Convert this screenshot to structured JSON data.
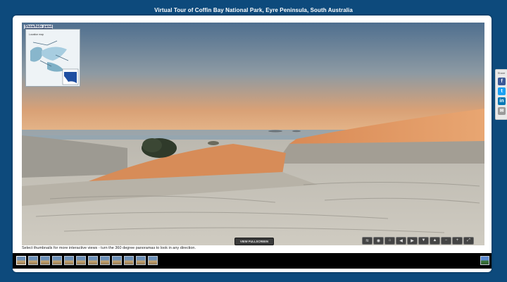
{
  "page": {
    "title": "Virtual Tour of Coffin Bay National Park, Eyre Peninsula, South Australia"
  },
  "map_panel": {
    "toggle_label": "Show/hide panel",
    "map_label": "Location map"
  },
  "viewer": {
    "fullscreen_label": "VIEW FULLSCREEN",
    "nav_buttons": [
      {
        "icon": "wifi-icon",
        "glyph": "≋"
      },
      {
        "icon": "hotspot-icon",
        "glyph": "◉"
      },
      {
        "icon": "home-icon",
        "glyph": "⌂"
      },
      {
        "icon": "arrow-left-icon",
        "glyph": "◀"
      },
      {
        "icon": "arrow-right-icon",
        "glyph": "▶"
      },
      {
        "icon": "arrow-down-icon",
        "glyph": "▼"
      },
      {
        "icon": "arrow-up-icon",
        "glyph": "▲"
      },
      {
        "icon": "zoom-out-icon",
        "glyph": "−"
      },
      {
        "icon": "zoom-in-icon",
        "glyph": "+"
      },
      {
        "icon": "fullscreen-icon",
        "glyph": "⤢"
      }
    ]
  },
  "caption": "Select thumbnails for more interactive views - turn the 360 degree panoramas to look in any direction.",
  "thumbnails": {
    "count": 12,
    "active_index": 0
  },
  "share": {
    "label": "Share",
    "buttons": [
      {
        "name": "facebook",
        "glyph": "f",
        "color": "#3b5998"
      },
      {
        "name": "twitter",
        "glyph": "t",
        "color": "#1da1f2"
      },
      {
        "name": "linkedin",
        "glyph": "in",
        "color": "#0077b5"
      },
      {
        "name": "email",
        "glyph": "✉",
        "color": "#9a9a9a"
      }
    ]
  },
  "colors": {
    "background": "#0d4a7c",
    "frame": "#ffffff",
    "strip": "#000000"
  }
}
